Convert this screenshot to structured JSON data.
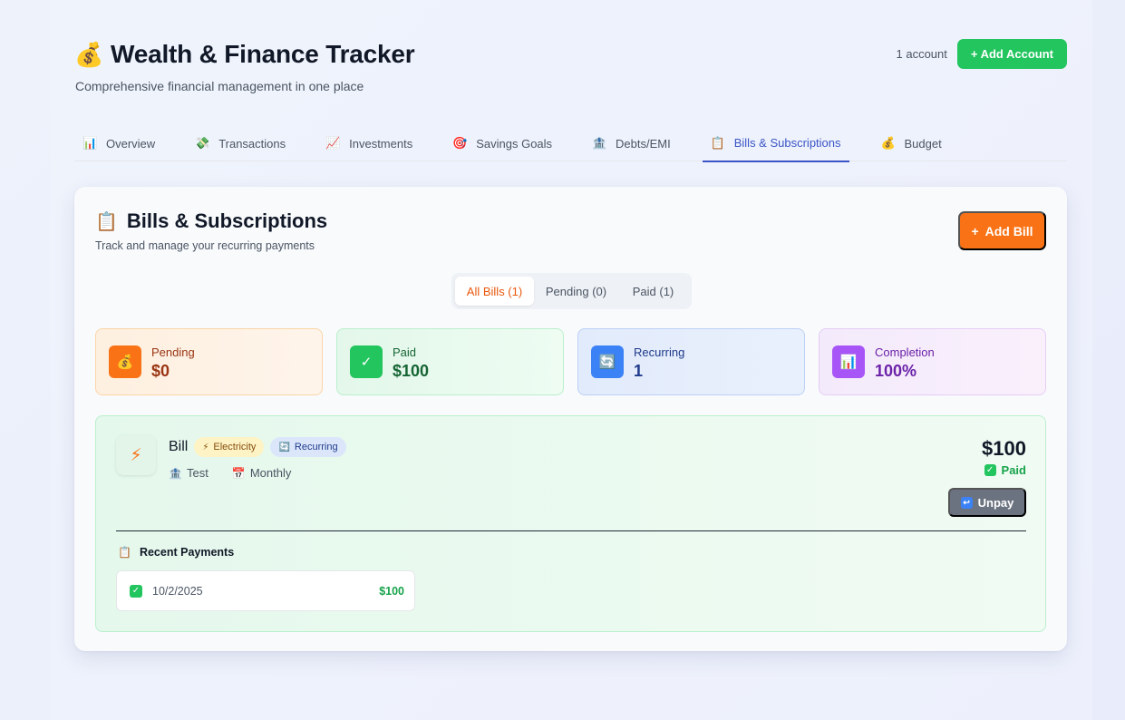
{
  "app": {
    "title_emoji": "💰",
    "title": "Wealth & Finance Tracker",
    "subtitle": "Comprehensive financial management in one place",
    "account_count": "1 account",
    "add_account_label": "+ Add Account"
  },
  "tabs": [
    {
      "icon": "📊",
      "label": "Overview",
      "active": false
    },
    {
      "icon": "💸",
      "label": "Transactions",
      "active": false
    },
    {
      "icon": "📈",
      "label": "Investments",
      "active": false
    },
    {
      "icon": "🎯",
      "label": "Savings Goals",
      "active": false
    },
    {
      "icon": "🏦",
      "label": "Debts/EMI",
      "active": false
    },
    {
      "icon": "📋",
      "label": "Bills & Subscriptions",
      "active": true
    },
    {
      "icon": "💰",
      "label": "Budget",
      "active": false
    }
  ],
  "bills": {
    "title_emoji": "📋",
    "title": "Bills & Subscriptions",
    "subtitle": "Track and manage your recurring payments",
    "add_bill_icon": "+",
    "add_bill_label": "Add Bill",
    "filters": [
      {
        "label": "All Bills (1)",
        "active": true
      },
      {
        "label": "Pending (0)",
        "active": false
      },
      {
        "label": "Paid (1)",
        "active": false
      }
    ],
    "stats": {
      "pending": {
        "icon": "💰",
        "label": "Pending",
        "value": "$0"
      },
      "paid": {
        "icon": "✓",
        "label": "Paid",
        "value": "$100"
      },
      "recurring": {
        "icon": "🔄",
        "label": "Recurring",
        "value": "1"
      },
      "completion": {
        "icon": "📊",
        "label": "Completion",
        "value": "100%"
      }
    },
    "item": {
      "icon": "⚡",
      "name": "Bill",
      "category_icon": "⚡",
      "category": "Electricity",
      "recurring_icon": "🔄",
      "recurring_label": "Recurring",
      "account_icon": "🏦",
      "account": "Test",
      "frequency_icon": "📅",
      "frequency": "Monthly",
      "amount": "$100",
      "status": "Paid",
      "unpay_icon": "↩",
      "unpay_label": "Unpay",
      "recent_title_icon": "📋",
      "recent_title": "Recent Payments",
      "payments": [
        {
          "date": "10/2/2025",
          "amount": "$100"
        }
      ]
    }
  },
  "colors": {
    "accent_blue": "#3b55c6",
    "green": "#22c55e",
    "orange": "#f97316",
    "purple": "#a855f7",
    "gray_button": "#6b7280"
  }
}
